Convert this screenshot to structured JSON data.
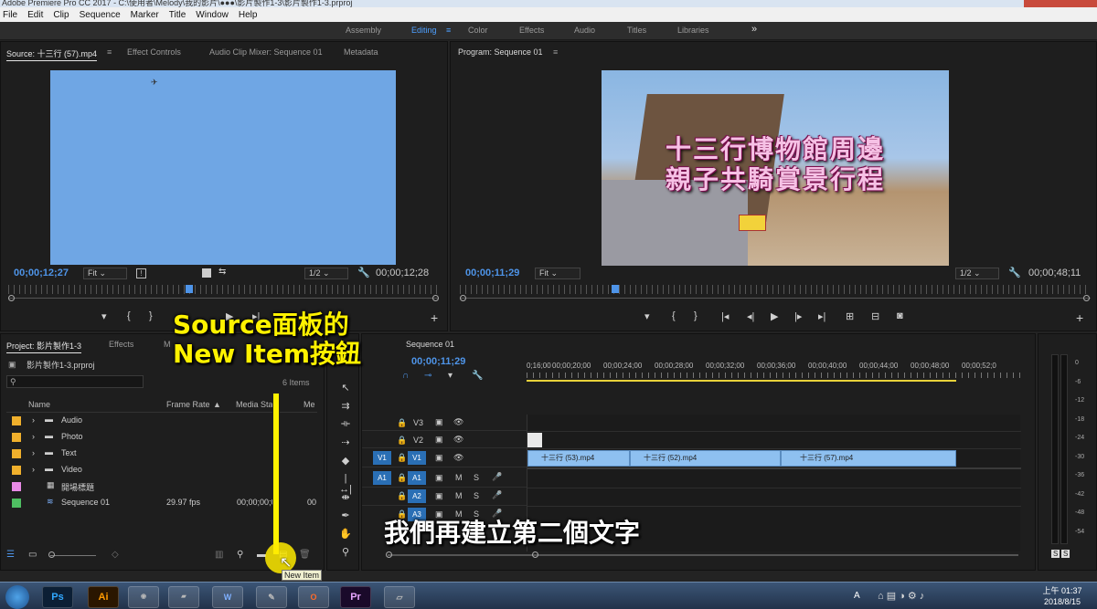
{
  "app": {
    "title": "Adobe Premiere Pro CC 2017 - C:\\使用者\\Melody\\我的影片\\●●●\\影片製作1-3\\影片製作1-3.prproj",
    "menu": [
      "File",
      "Edit",
      "Clip",
      "Sequence",
      "Marker",
      "Title",
      "Window",
      "Help"
    ]
  },
  "workspaces": {
    "items": [
      "Assembly",
      "Editing",
      "Color",
      "Effects",
      "Audio",
      "Titles",
      "Libraries"
    ],
    "active": "Editing",
    "more": "»"
  },
  "source_panel": {
    "tabs": [
      "Source: 十三行 (57).mp4",
      "Effect Controls",
      "Audio Clip Mixer: Sequence 01",
      "Metadata"
    ],
    "timecode_in": "00;00;12;27",
    "fit": "Fit",
    "resolution": "1/2",
    "timecode_duration": "00;00;12;28"
  },
  "program_panel": {
    "tab": "Program: Sequence 01",
    "timecode_in": "00;00;11;29",
    "fit": "Fit",
    "resolution": "1/2",
    "timecode_duration": "00;00;48;11",
    "video_title_line1": "十三行博物館周邊",
    "video_title_line2": "親子共騎賞景行程"
  },
  "project_panel": {
    "tabs": [
      "Project: 影片製作1-3",
      "Effects",
      "M"
    ],
    "file": "影片製作1-3.prproj",
    "item_count": "6 Items",
    "columns": [
      "Name",
      "Frame Rate",
      "Media Start",
      "Me"
    ],
    "rows": [
      {
        "name": "Audio",
        "color": "#f0b02c",
        "type": "folder"
      },
      {
        "name": "Photo",
        "color": "#f0b02c",
        "type": "folder"
      },
      {
        "name": "Text",
        "color": "#f0b02c",
        "type": "folder"
      },
      {
        "name": "Video",
        "color": "#f0b02c",
        "type": "folder"
      },
      {
        "name": "開場標題",
        "color": "#e88ae6",
        "type": "title"
      },
      {
        "name": "Sequence 01",
        "color": "#4fbf62",
        "type": "sequence",
        "frame_rate": "29.97 fps",
        "media_start": "00;00;00;0",
        "extra": "00"
      }
    ],
    "tooltip": "New Item"
  },
  "timeline": {
    "tab": "Sequence 01",
    "timecode": "00;00;11;29",
    "ruler": [
      "0;16;00",
      "00;00;20;00",
      "00;00;24;00",
      "00;00;28;00",
      "00;00;32;00",
      "00;00;36;00",
      "00;00;40;00",
      "00;00;44;00",
      "00;00;48;00",
      "00;00;52;0"
    ],
    "video_tracks": [
      "V3",
      "V2",
      "V1"
    ],
    "audio_tracks": [
      "A1",
      "A2",
      "A3"
    ],
    "source_patch_video": "V1",
    "source_patch_audio": "A1",
    "clips": [
      "十三行 (53).mp4",
      "十三行 (52).mp4",
      "十三行 (57).mp4"
    ]
  },
  "audio_meter": {
    "scale": [
      "0",
      "-6",
      "-12",
      "-18",
      "-24",
      "-30",
      "-36",
      "-42",
      "-48",
      "-54"
    ],
    "solo_labels": [
      "S",
      "S"
    ]
  },
  "overlay": {
    "annotation_line1": "Source面板的",
    "annotation_line2": "New Item按鈕",
    "subtitle": "我們再建立第二個文字"
  },
  "taskbar": {
    "apps": [
      "Ps",
      "Ai",
      "Chrome",
      "Explorer",
      "Word",
      "Paint",
      "Office",
      "Pr",
      "Notes"
    ],
    "clock_time": "上午 01:37",
    "clock_date": "2018/8/15",
    "ime": "A"
  }
}
